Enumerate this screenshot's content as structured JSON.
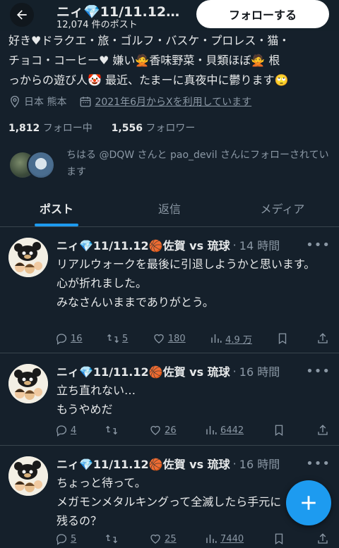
{
  "header": {
    "title": "ニィ💎11/11.12…",
    "post_count": "12,074 件のポスト",
    "follow_label": "フォローする"
  },
  "profile": {
    "bio_lines": [
      "好き♥ドラクエ・旅・ゴルフ・バスケ・プロレス・猫・",
      "チョコ・コーヒー♥ 嫌い🙅香味野菜・貝類ほぼ🙅 根",
      "っからの遊び人🤡 最近、たまーに真夜中に鬱ります🙄"
    ],
    "location": "日本 熊本",
    "joined": "2021年6月からXを利用しています",
    "following_count": "1,812",
    "following_label": "フォロー中",
    "followers_count": "1,556",
    "followers_label": "フォロワー",
    "followed_by_text": "ちはる @DQW さんと pao_devil さんにフォローされています"
  },
  "tabs": [
    {
      "label": "ポスト",
      "active": true
    },
    {
      "label": "返信",
      "active": false
    },
    {
      "label": "メディア",
      "active": false
    }
  ],
  "tweets": [
    {
      "name": "ニィ💎11/11.12🏀佐賀 vs 琉球",
      "time": "14 時間",
      "body": "リアルウォークを最後に引退しようかと思います。\n心が折れました。\nみなさんいままでありがとう。",
      "replies": "16",
      "reposts": "5",
      "likes": "180",
      "views": "4.9 万"
    },
    {
      "name": "ニィ💎11/11.12🏀佐賀 vs 琉球",
      "time": "16 時間",
      "body": "立ち直れない…\nもうやめだ",
      "replies": "4",
      "reposts": "",
      "likes": "26",
      "views": "6442"
    },
    {
      "name": "ニィ💎11/11.12🏀佐賀 vs 琉球",
      "time": "16 時間",
      "body": "ちょっと待って。\nメガモンメタルキングって全滅したら手元に残るの？",
      "replies": "5",
      "reposts": "",
      "likes": "25",
      "views": "7440"
    }
  ],
  "colors": {
    "background": "#15202b",
    "accent": "#1d9bf0",
    "muted": "#8b98a5",
    "divider": "#38444d"
  },
  "icons": [
    "back-arrow-icon",
    "location-icon",
    "calendar-icon",
    "reply-icon",
    "repost-icon",
    "like-icon",
    "views-icon",
    "bookmark-icon",
    "share-icon",
    "plus-icon"
  ]
}
